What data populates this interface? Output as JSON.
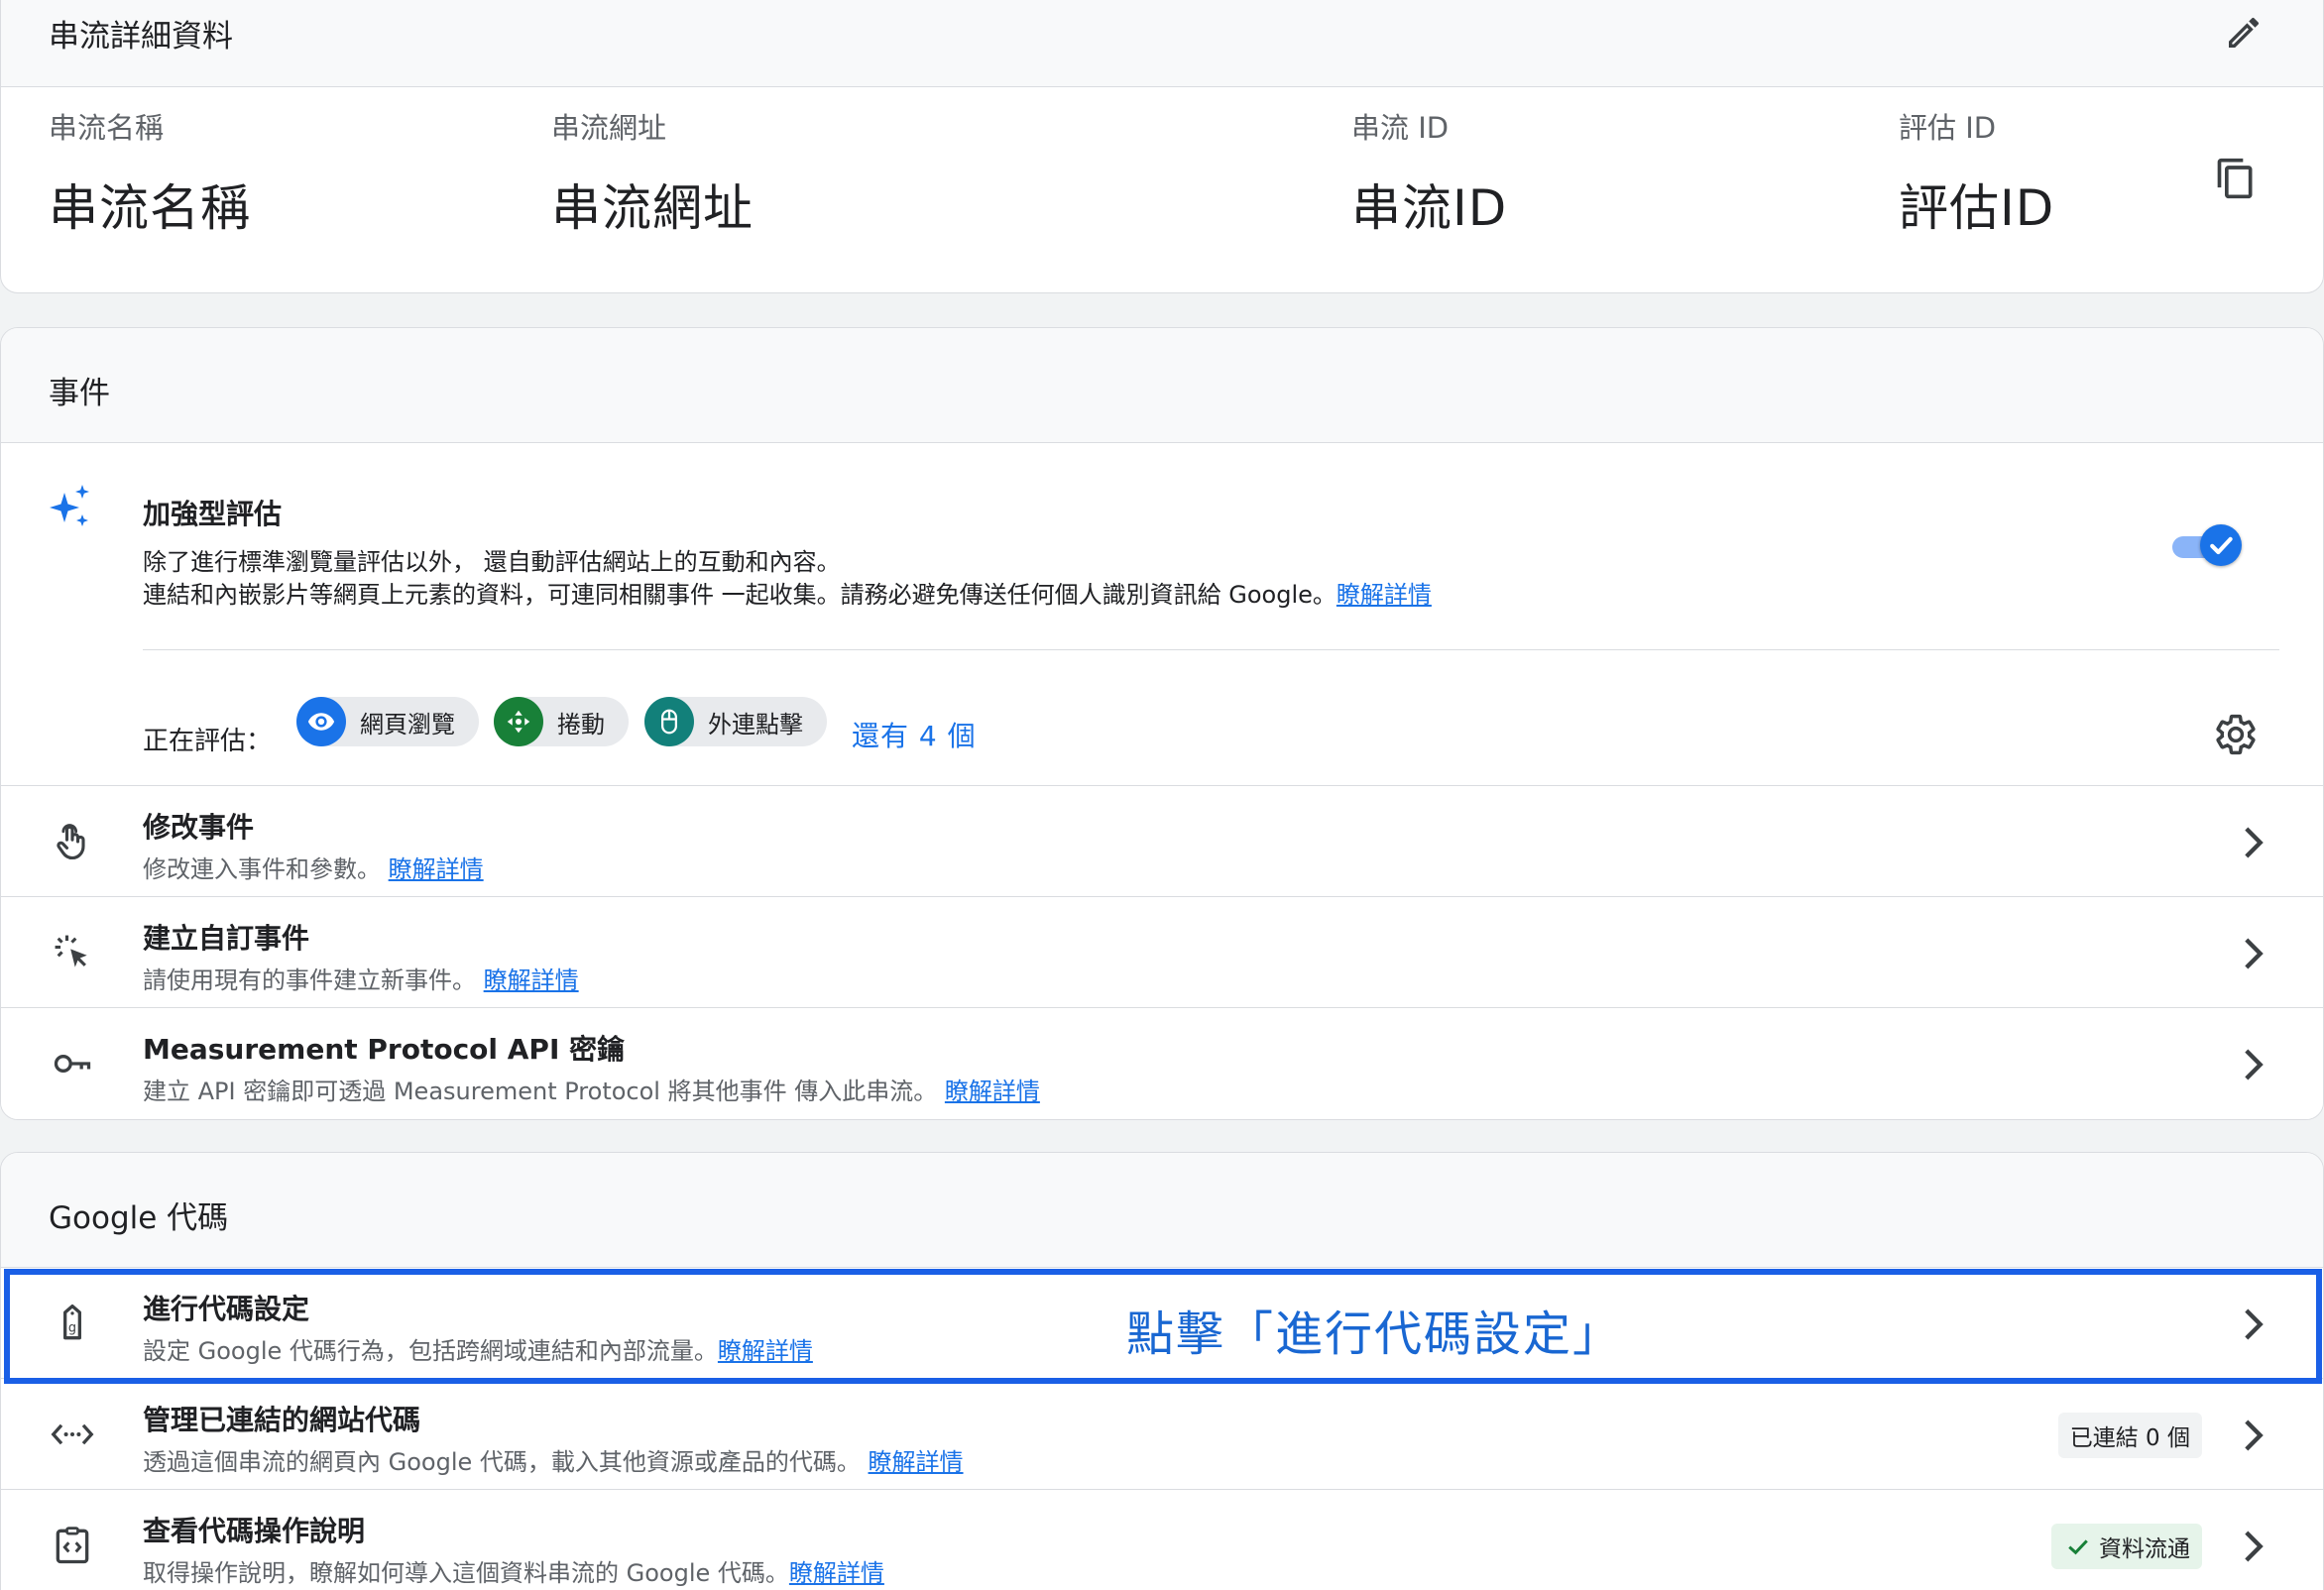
{
  "stream_details": {
    "title": "串流詳細資料",
    "fields": [
      {
        "label": "串流名稱",
        "value": "串流名稱"
      },
      {
        "label": "串流網址",
        "value": "串流網址"
      },
      {
        "label": "串流 ID",
        "value": "串流ID"
      },
      {
        "label": "評估 ID",
        "value": "評估ID"
      }
    ]
  },
  "events": {
    "title": "事件",
    "enhanced": {
      "title": "加強型評估",
      "desc_line1": "除了進行標準瀏覽量評估以外， 還自動評估網站上的互動和內容。",
      "desc_line2": "連結和內嵌影片等網頁上元素的資料，可連同相關事件 一起收集。請務必避免傳送任何個人識別資訊給 Google。",
      "learn_more": "瞭解詳情",
      "toggle_on": true,
      "measuring_label": "正在評估：",
      "chips": [
        {
          "label": "網頁瀏覽",
          "icon": "eye-icon",
          "color": "#1a73e8"
        },
        {
          "label": "捲動",
          "icon": "scroll-arrows-icon",
          "color": "#188038"
        },
        {
          "label": "外連點擊",
          "icon": "mouse-icon",
          "color": "#12807a"
        }
      ],
      "more_link": "還有 4 個"
    },
    "rows": [
      {
        "title": "修改事件",
        "desc": "修改連入事件和參數。",
        "link": "瞭解詳情",
        "icon": "touch-hand-icon"
      },
      {
        "title": "建立自訂事件",
        "desc": "請使用現有的事件建立新事件。",
        "link": "瞭解詳情",
        "icon": "click-cursor-icon"
      },
      {
        "title": "Measurement Protocol API 密鑰",
        "desc": "建立 API 密鑰即可透過 Measurement Protocol 將其他事件 傳入此串流。",
        "link": "瞭解詳情",
        "icon": "key-icon"
      }
    ]
  },
  "google_tag": {
    "title": "Google 代碼",
    "rows": [
      {
        "title": "進行代碼設定",
        "desc": "設定 Google 代碼行為，包括跨網域連結和內部流量。",
        "link": "瞭解詳情",
        "icon": "tag-g-icon"
      },
      {
        "title": "管理已連結的網站代碼",
        "desc": "透過這個串流的網頁內 Google 代碼，載入其他資源或產品的代碼。",
        "link": "瞭解詳情",
        "icon": "code-arrows-icon",
        "badge": "已連結 0 個"
      },
      {
        "title": "查看代碼操作說明",
        "desc": "取得操作說明，瞭解如何導入這個資料串流的 Google 代碼。",
        "link": "瞭解詳情",
        "icon": "clipboard-code-icon",
        "badge": "資料流通",
        "badge_color": "#e6f4ea"
      }
    ]
  },
  "annotation": "點擊「進行代碼設定」",
  "colors": {
    "accent": "#1a73e8",
    "highlight": "#1a5fe6",
    "green": "#188038"
  }
}
